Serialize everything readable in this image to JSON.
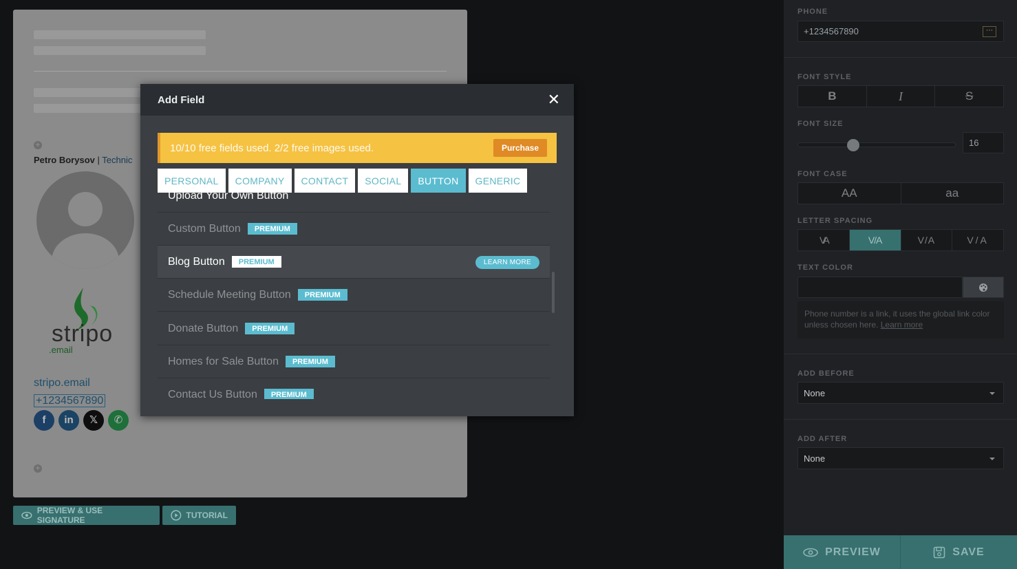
{
  "signature": {
    "name": "Petro Borysov",
    "separator": " | ",
    "title_partial": "Technic",
    "logo_text": "stripo",
    "logo_sub": ".email",
    "link": "stripo.email",
    "phone": "+1234567890",
    "socials": [
      "facebook-icon",
      "linkedin-icon",
      "x-icon",
      "whatsapp-icon"
    ]
  },
  "bottom_buttons": {
    "preview_use": "PREVIEW & USE SIGNATURE",
    "tutorial": "TUTORIAL"
  },
  "panel": {
    "phone_label": "PHONE",
    "phone_value": "+1234567890",
    "font_style_label": "FONT STYLE",
    "font_style_options": [
      "B",
      "I",
      "S"
    ],
    "font_size_label": "FONT SIZE",
    "font_size_value": "16",
    "font_case_label": "FONT CASE",
    "font_case_options": [
      "AA",
      "aa"
    ],
    "letter_spacing_label": "LETTER SPACING",
    "letter_spacing_options": [
      "VA",
      "V/A",
      "V/A",
      "V/A"
    ],
    "letter_spacing_selected": 1,
    "text_color_label": "TEXT COLOR",
    "note_text": "Phone number is a link, it uses the global link color unless chosen here.",
    "note_link": "Learn more",
    "add_before_label": "ADD BEFORE",
    "add_before_value": "None",
    "add_after_label": "ADD AFTER",
    "add_after_value": "None",
    "preview_button": "PREVIEW",
    "save_button": "SAVE"
  },
  "modal": {
    "title": "Add Field",
    "banner_text": "10/10 free fields used. 2/2 free images used.",
    "purchase_label": "Purchase",
    "tabs": [
      "PERSONAL",
      "COMPANY",
      "CONTACT",
      "SOCIAL",
      "BUTTON",
      "GENERIC"
    ],
    "active_tab": "BUTTON",
    "items": [
      {
        "name": "Upload Your Own Button",
        "badge": ""
      },
      {
        "name": "Custom Button",
        "badge": "PREMIUM"
      },
      {
        "name": "Blog Button",
        "badge": "PREMIUM",
        "learn_more": "LEARN MORE"
      },
      {
        "name": "Schedule Meeting Button",
        "badge": "PREMIUM"
      },
      {
        "name": "Donate Button",
        "badge": "PREMIUM"
      },
      {
        "name": "Homes for Sale Button",
        "badge": "PREMIUM"
      },
      {
        "name": "Contact Us Button",
        "badge": "PREMIUM"
      }
    ]
  },
  "colors": {
    "accent": "#5bbcd0",
    "banner": "#f5c242",
    "purchase": "#df8a25",
    "teal_button": "#37706f"
  }
}
